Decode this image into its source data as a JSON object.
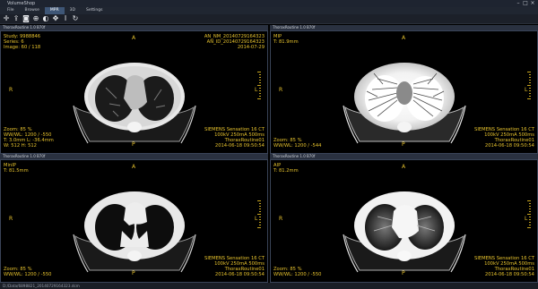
{
  "app": {
    "title": "VolumeShop"
  },
  "menu": {
    "items": [
      "File",
      "Browse",
      "MPR",
      "3D",
      "Settings"
    ],
    "active_index": 2
  },
  "toolbar": {
    "icons": [
      "crosshair-icon",
      "export-icon",
      "screenshot-icon",
      "zoom-icon",
      "contrast-icon",
      "pan-icon",
      "measure-icon",
      "refresh-icon"
    ]
  },
  "viewports": [
    {
      "header": "ThoraxRoutine  1.0  B70f",
      "top_left": [
        "Study: 9988846",
        "Series: 6",
        "Image: 60 / 118"
      ],
      "top_right": [
        "AN_NM_20140729164323",
        "AN_ID_20140729164323",
        "",
        "2014-07-29"
      ],
      "bottom_left": [
        "Zoom: 85 %",
        "WW/WL: 1200 / -550",
        "T: 3.0mm  L: -36.4mm",
        "W: 512  H: 512"
      ],
      "bottom_right": [
        "SIEMENS  Sensation 16  CT",
        "100kV  250mA  500ms",
        "ThoraxRoutine01",
        "2014-06-18 09:50:54"
      ],
      "markers": {
        "top": "A",
        "left": "R",
        "right": "L",
        "bottom": "P"
      }
    },
    {
      "header": "ThoraxRoutine  1.0  B70f",
      "top_left": [
        "MIP",
        "T: 81.9mm"
      ],
      "top_right": [],
      "bottom_left": [
        "Zoom: 85 %",
        "WW/WL: 1200 / -544"
      ],
      "bottom_right": [
        "SIEMENS  Sensation 16  CT",
        "100kV  250mA  500ms",
        "ThoraxRoutine01",
        "2014-06-18 09:50:54"
      ],
      "markers": {
        "top": "A",
        "left": "R",
        "right": "L",
        "bottom": "P"
      }
    },
    {
      "header": "ThoraxRoutine  1.0  B70f",
      "top_left": [
        "MinIP",
        "T: 81.5mm"
      ],
      "top_right": [],
      "bottom_left": [
        "Zoom: 85 %",
        "WW/WL: 1200 / -550"
      ],
      "bottom_right": [
        "SIEMENS  Sensation 16  CT",
        "100kV  250mA  500ms",
        "ThoraxRoutine01",
        "2014-06-18 09:50:54"
      ],
      "markers": {
        "top": "A",
        "left": "R",
        "right": "L",
        "bottom": "P"
      }
    },
    {
      "header": "ThoraxRoutine  1.0  B70f",
      "top_left": [
        "AIP",
        "T: 81.2mm"
      ],
      "top_right": [],
      "bottom_left": [
        "Zoom: 85 %",
        "WW/WL: 1200 / -550"
      ],
      "bottom_right": [
        "SIEMENS  Sensation 16  CT",
        "100kV  250mA  500ms",
        "ThoraxRoutine01",
        "2014-06-18 09:50:54"
      ],
      "markers": {
        "top": "A",
        "left": "R",
        "right": "L",
        "bottom": "P"
      }
    }
  ],
  "status": {
    "text": "D:/Data/6898821_20140729164323.dcm"
  },
  "colors": {
    "overlay": "#e6c22d",
    "accent": "#3e5676"
  }
}
